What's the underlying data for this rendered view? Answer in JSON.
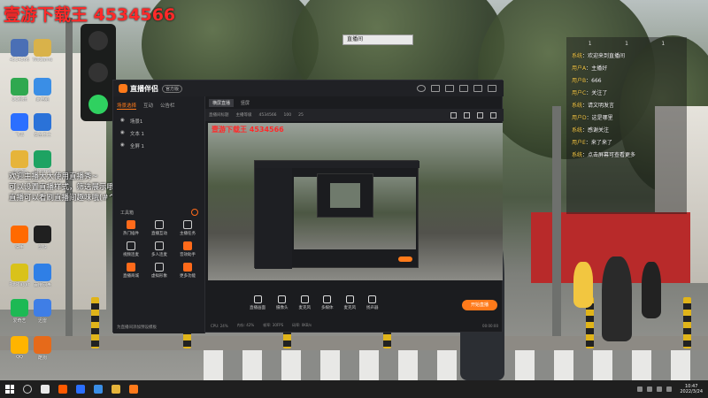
{
  "overlay": {
    "top_title": "壹游下载王 4534566",
    "caption_line1": "欢迎主播大大使用直播秀~",
    "caption_line2": "可以设置直播样式，筛选展示哦~",
    "caption_line3": "直播可以看刷直播间趣味哦(#^0^#)",
    "preview_red_text": "壹游下载王 4534566",
    "float_label": "直播间"
  },
  "desktop_icons": [
    {
      "label": "4534566",
      "color": "#4a6fb5"
    },
    {
      "label": "WeGame",
      "color": "#d9b24a"
    },
    {
      "label": "QQ音乐",
      "color": "#2fa84f"
    },
    {
      "label": "此电脑",
      "color": "#3a8ee6"
    },
    {
      "label": "飞书",
      "color": "#2b6fff"
    },
    {
      "label": "安全卫士",
      "color": "#2a72d8"
    },
    {
      "label": "文件夹",
      "color": "#e6b43a"
    },
    {
      "label": "Chrome",
      "color": "#1ea362"
    },
    {
      "label": "快手",
      "color": "#ff6a00"
    },
    {
      "label": "剪映",
      "color": "#202020"
    },
    {
      "label": "PotPlayer",
      "color": "#d9c21a"
    },
    {
      "label": "百度网盘",
      "color": "#2f7fe6"
    },
    {
      "label": "爱奇艺",
      "color": "#1db954"
    },
    {
      "label": "迅雷",
      "color": "#3f7ee6"
    },
    {
      "label": "QQ",
      "color": "#ffb400"
    },
    {
      "label": "酷狗",
      "color": "#e66a1a"
    }
  ],
  "app": {
    "title": "直播伴侣",
    "badge": "官方版",
    "left_tabs": [
      "场景选择",
      "互动",
      "公告栏"
    ],
    "scenes": [
      "场景1",
      "文本 1",
      "全屏 1"
    ],
    "tools_title": "工具箱",
    "tools": [
      {
        "label": "热门插件",
        "hot": true
      },
      {
        "label": "直播互动",
        "hot": false
      },
      {
        "label": "主播任务",
        "hot": false
      },
      {
        "label": "视频连麦",
        "hot": false
      },
      {
        "label": "多人连麦",
        "hot": false
      },
      {
        "label": "音效助手",
        "hot": true
      },
      {
        "label": "直播商城",
        "hot": true
      },
      {
        "label": "虚拟形象",
        "hot": false
      },
      {
        "label": "更多功能",
        "hot": true
      }
    ],
    "left_footer": "为直播间添加预设模板",
    "preview_tabs": [
      "横屏直播",
      "竖屏"
    ],
    "preview_info": [
      "直播间标题",
      "主播等级",
      "4534566",
      "100",
      "25"
    ],
    "bottom_tools": [
      "直播画面",
      "摄像头",
      "麦克风",
      "多媒体",
      "麦克风",
      "扬声器"
    ],
    "go_live": "开始直播",
    "status": [
      "CPU: 24%",
      "内存: 42%",
      "帧率: 30FPS",
      "码率: 0KB/s"
    ],
    "status_right": "00:00:00"
  },
  "chat": {
    "head": [
      "1",
      "1",
      "1"
    ],
    "messages": [
      {
        "user": "系统",
        "text": "欢迎来到直播间"
      },
      {
        "user": "用户A",
        "text": "主播好"
      },
      {
        "user": "用户B",
        "text": "666"
      },
      {
        "user": "用户C",
        "text": "关注了"
      },
      {
        "user": "系统",
        "text": "请文明发言"
      },
      {
        "user": "用户D",
        "text": "这是哪里"
      },
      {
        "user": "系统",
        "text": "感谢关注"
      },
      {
        "user": "用户E",
        "text": "来了来了"
      },
      {
        "user": "系统",
        "text": "点击屏幕可查看更多"
      }
    ]
  },
  "taskbar": {
    "time": "10:47",
    "date": "2022/3/24",
    "apps": [
      "#e8e8e8",
      "#ff5a00",
      "#2b6fff",
      "#3a8ee6",
      "#e6b43a",
      "#ff7a1a"
    ]
  },
  "colors": {
    "accent": "#ff7a1a",
    "overlay_red": "#ff2a2a"
  }
}
